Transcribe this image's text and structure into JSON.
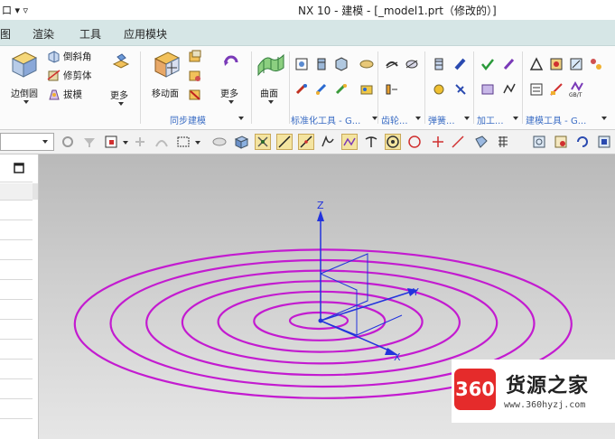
{
  "titlebar": {
    "left_fragment": "口 ▾ ▿",
    "title": "NX 10 - 建模 - [_model1.prt（修改的）]"
  },
  "menu": {
    "items": [
      "图",
      "渲染",
      "工具",
      "应用模块"
    ]
  },
  "ribbon": {
    "edge_blend_label": "边倒圆",
    "chamfer_label": "倒斜角",
    "shell_label": "修剪体",
    "draft_label": "拔模",
    "more_label_1": "更多",
    "move_face_label": "移动面",
    "more_label_2": "更多",
    "surface_label": "曲面",
    "sync_group_label": "同步建模",
    "standard_tools_label": "标准化工具 - G...",
    "gear_label": "齿轮...",
    "spring_label": "弹簧...",
    "machining_label": "加工...",
    "build_tools_label": "建模工具 - G...",
    "gb_label": "GB/T"
  },
  "toolbar": {
    "combo_value": ""
  },
  "graphics": {
    "curve_color": "#c31bd0",
    "axis_color": "#2233dd",
    "axes": {
      "z": "Z",
      "y": "Y",
      "x": "X"
    }
  },
  "watermark": {
    "badge": "360",
    "name": "货源之家",
    "url": "www.360hyzj.com"
  }
}
